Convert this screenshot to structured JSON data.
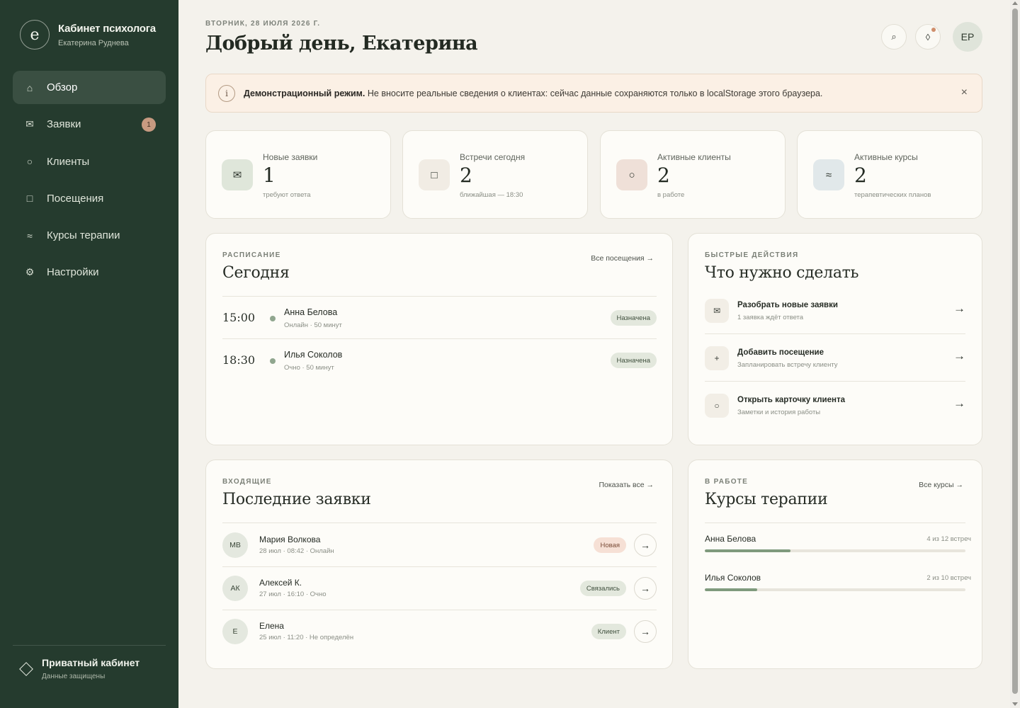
{
  "sidebar": {
    "logo_letter": "e",
    "title": "Кабинет психолога",
    "subtitle": "Екатерина Руднева",
    "items": [
      {
        "label": "Обзор",
        "icon": "⌂",
        "icon_name": "home-icon",
        "active": true
      },
      {
        "label": "Заявки",
        "icon": "✉",
        "icon_name": "mail-icon",
        "badge": "1"
      },
      {
        "label": "Клиенты",
        "icon": "○",
        "icon_name": "circle-user-icon"
      },
      {
        "label": "Посещения",
        "icon": "□",
        "icon_name": "square-calendar-icon"
      },
      {
        "label": "Курсы терапии",
        "icon": "≈",
        "icon_name": "wave-icon"
      },
      {
        "label": "Настройки",
        "icon": "⚙",
        "icon_name": "gear-icon"
      }
    ],
    "footer": {
      "title": "Приватный кабинет",
      "subtitle": "Данные защищены"
    }
  },
  "header": {
    "date": "ВТОРНИК, 28 ИЮЛЯ 2026 Г.",
    "greeting": "Добрый день, Екатерина",
    "search_icon": "⌕",
    "notify_icon": "◊",
    "avatar": "ЕР"
  },
  "banner": {
    "icon": "i",
    "bold": "Демонстрационный режим.",
    "text": " Не вносите реальные сведения о клиентах: сейчас данные сохраняются только в localStorage этого браузера.",
    "close": "×"
  },
  "stats": [
    {
      "label": "Новые заявки",
      "value": "1",
      "sub": "требуют ответа",
      "icon": "✉",
      "bg": "#dfe6da"
    },
    {
      "label": "Встречи сегодня",
      "value": "2",
      "sub": "ближайшая — 18:30",
      "icon": "□",
      "bg": "#f1ece4"
    },
    {
      "label": "Активные клиенты",
      "value": "2",
      "sub": "в работе",
      "icon": "○",
      "bg": "#efe0d8"
    },
    {
      "label": "Активные курсы",
      "value": "2",
      "sub": "терапевтических планов",
      "icon": "≈",
      "bg": "#e1e8ea"
    }
  ],
  "schedule": {
    "kicker": "РАСПИСАНИЕ",
    "title": "Сегодня",
    "link": "Все посещения →",
    "rows": [
      {
        "time": "15:00",
        "name": "Анна Белова",
        "meta": "Онлайн · 50 минут",
        "status": "Назначена"
      },
      {
        "time": "18:30",
        "name": "Илья Соколов",
        "meta": "Очно · 50 минут",
        "status": "Назначена"
      }
    ]
  },
  "quick": {
    "kicker": "БЫСТРЫЕ ДЕЙСТВИЯ",
    "title": "Что нужно сделать",
    "rows": [
      {
        "icon": "✉",
        "title": "Разобрать новые заявки",
        "sub": "1 заявка ждёт ответа",
        "arrow": "→"
      },
      {
        "icon": "+",
        "title": "Добавить посещение",
        "sub": "Запланировать встречу клиенту",
        "arrow": "→"
      },
      {
        "icon": "○",
        "title": "Открыть карточку клиента",
        "sub": "Заметки и история работы",
        "arrow": "→"
      }
    ]
  },
  "requests": {
    "kicker": "ВХОДЯЩИЕ",
    "title": "Последние заявки",
    "link": "Показать все →",
    "rows": [
      {
        "initials": "МВ",
        "name": "Мария Волкова",
        "meta": "28 июл · 08:42 · Онлайн",
        "status": "Новая",
        "arrow": "→"
      },
      {
        "initials": "АК",
        "name": "Алексей К.",
        "meta": "27 июл · 16:10 · Очно",
        "status": "Связались",
        "arrow": "→"
      },
      {
        "initials": "Е",
        "name": "Елена",
        "meta": "25 июл · 11:20 · Не определён",
        "status": "Клиент",
        "arrow": "→"
      }
    ]
  },
  "courses": {
    "kicker": "В РАБОТЕ",
    "title": "Курсы терапии",
    "link": "Все курсы →",
    "rows": [
      {
        "name": "Анна Белова",
        "count": "4 из 12 встреч",
        "progress": 0.33
      },
      {
        "name": "Илья Соколов",
        "count": "2 из 10 встреч",
        "progress": 0.2
      }
    ]
  }
}
